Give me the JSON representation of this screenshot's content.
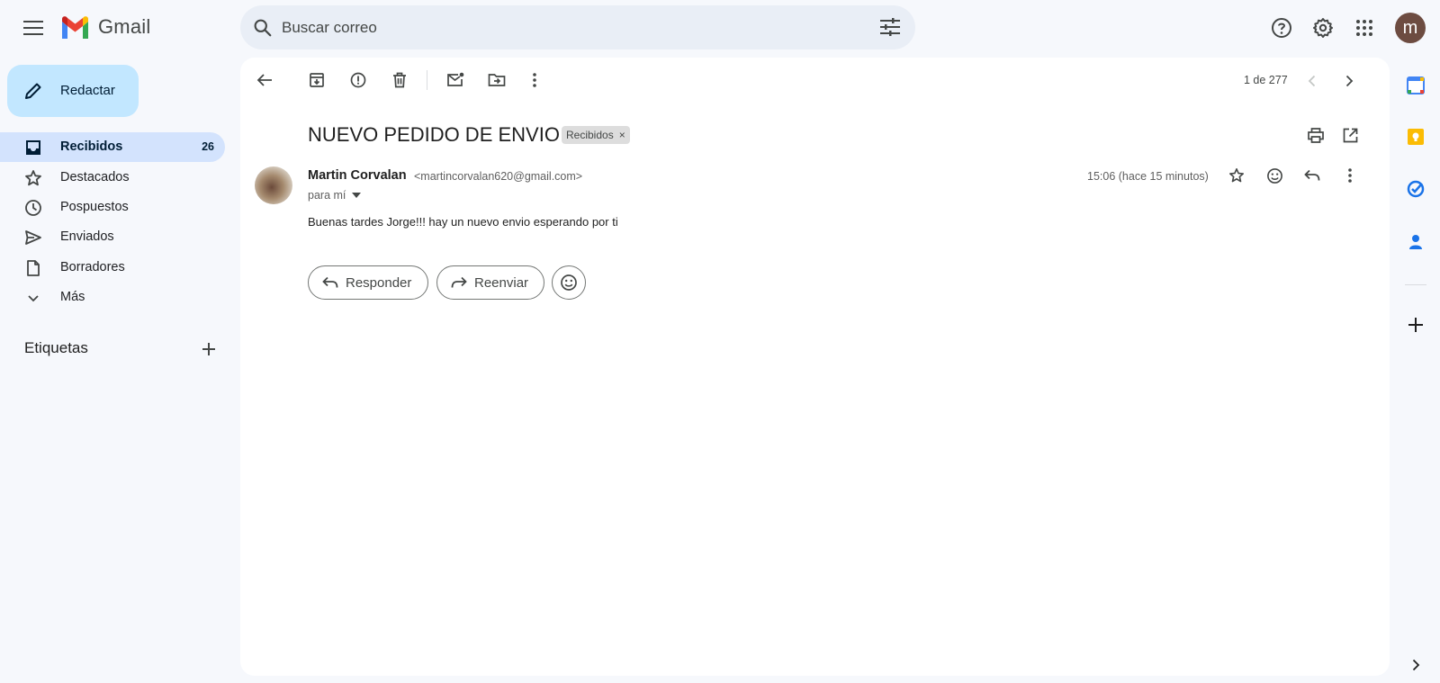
{
  "app": {
    "name": "Gmail"
  },
  "header": {
    "search_placeholder": "Buscar correo",
    "avatar_initial": "m"
  },
  "sidebar": {
    "compose_label": "Redactar",
    "items": [
      {
        "label": "Recibidos",
        "count": "26",
        "icon": "inbox-icon",
        "active": true
      },
      {
        "label": "Destacados",
        "icon": "star-icon"
      },
      {
        "label": "Pospuestos",
        "icon": "clock-icon"
      },
      {
        "label": "Enviados",
        "icon": "send-icon"
      },
      {
        "label": "Borradores",
        "icon": "draft-icon"
      },
      {
        "label": "Más",
        "icon": "chevron-down-icon"
      }
    ],
    "labels_title": "Etiquetas"
  },
  "toolbar": {
    "pager": "1 de 277"
  },
  "message": {
    "subject": "NUEVO PEDIDO DE ENVIO",
    "label_chip": "Recibidos",
    "label_chip_close": "×",
    "sender_name": "Martin Corvalan",
    "sender_email": "<martincorvalan620@gmail.com>",
    "to_me": "para mí",
    "timestamp": "15:06 (hace 15 minutos)",
    "body": "Buenas tardes Jorge!!! hay un nuevo envio esperando por ti"
  },
  "actions": {
    "reply_label": "Responder",
    "forward_label": "Reenviar"
  },
  "colors": {
    "background": "#f6f8fc",
    "compose_bg": "#c2e7ff",
    "active_nav_bg": "#d3e3fd",
    "search_bg": "#e9eef6",
    "avatar_bg": "#6d4c41"
  }
}
